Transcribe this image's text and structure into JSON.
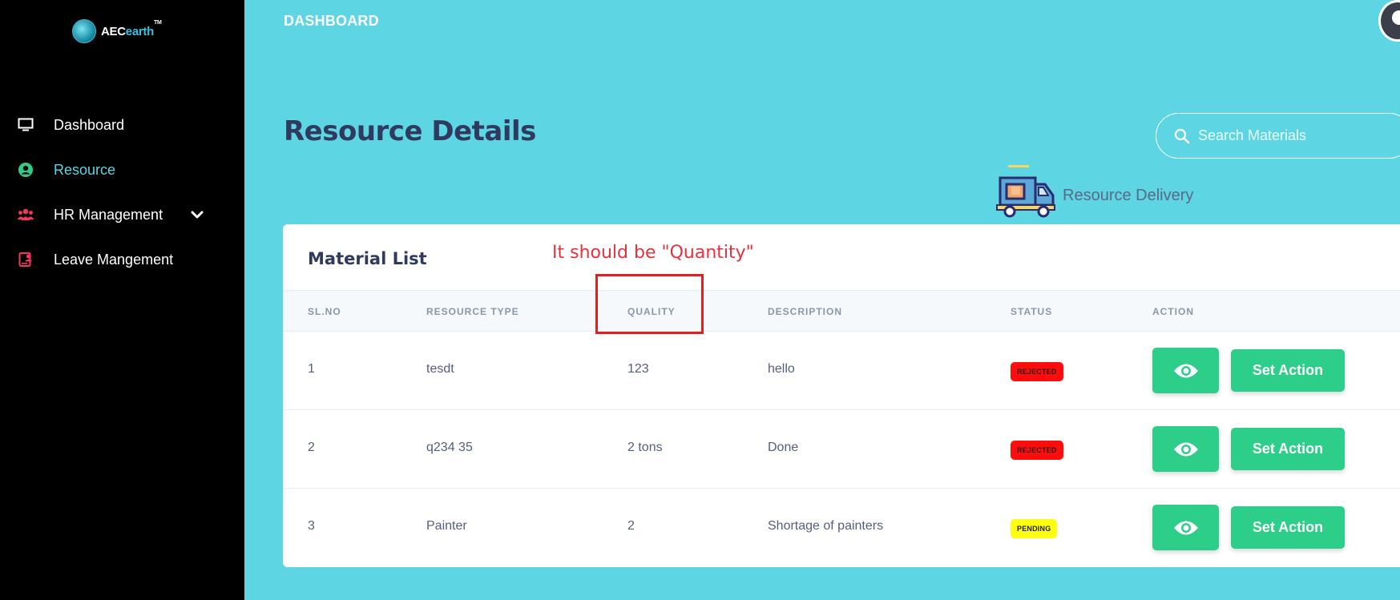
{
  "brand": {
    "name_prefix": "AEC",
    "name_suffix": "earth",
    "tm": "TM"
  },
  "sidebar": {
    "items": [
      {
        "label": "Dashboard",
        "icon": "monitor-icon"
      },
      {
        "label": "Resource",
        "icon": "user-circle-icon",
        "active": true
      },
      {
        "label": "HR Management",
        "icon": "users-icon",
        "has_submenu": true
      },
      {
        "label": "Leave Mangement",
        "icon": "id-card-icon"
      }
    ]
  },
  "header": {
    "title": "DASHBOARD"
  },
  "page": {
    "title": "Resource Details"
  },
  "search": {
    "placeholder": "Search Materials"
  },
  "delivery": {
    "label": "Resource Delivery"
  },
  "card": {
    "title": "Material List",
    "annotation": "It should be \"Quantity\"",
    "columns": [
      "SL.NO",
      "RESOURCE TYPE",
      "QUALITY",
      "DESCRIPTION",
      "STATUS",
      "ACTION"
    ],
    "rows": [
      {
        "sl": "1",
        "type": "tesdt",
        "quality": "123",
        "description": "hello",
        "status": "REJECTED",
        "action": "Set Action"
      },
      {
        "sl": "2",
        "type": "q234 35",
        "quality": "2 tons",
        "description": "Done",
        "status": "REJECTED",
        "action": "Set Action"
      },
      {
        "sl": "3",
        "type": "Painter",
        "quality": "2",
        "description": "Shortage of painters",
        "status": "PENDING",
        "action": "Set Action"
      }
    ]
  },
  "colors": {
    "accent": "#5dd5e3",
    "success": "#2dce89",
    "rejected": "#ff0d0d",
    "pending": "#fdfd12",
    "annotation": "#e6323c"
  }
}
